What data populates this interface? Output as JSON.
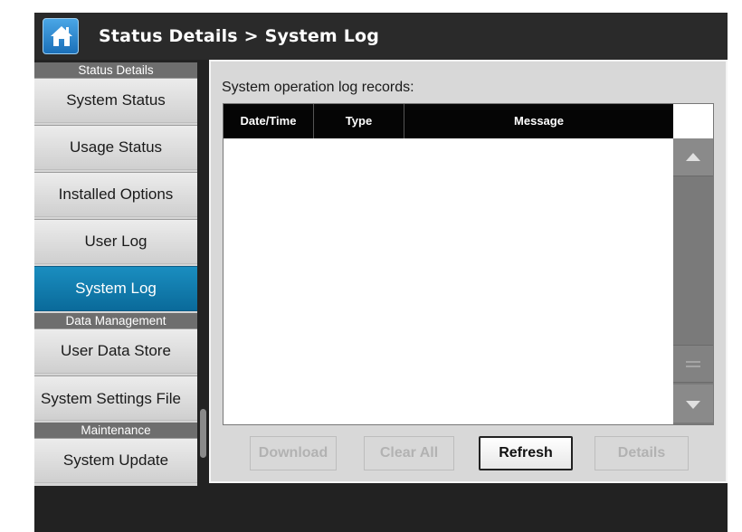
{
  "header": {
    "title": "Status Details > System Log",
    "home_icon": "home-icon"
  },
  "sidebar": {
    "sections": [
      {
        "title": "Status Details",
        "items": [
          "System Status",
          "Usage Status",
          "Installed Options",
          "User Log",
          "System Log"
        ]
      },
      {
        "title": "Data Management",
        "items": [
          "User Data Store",
          "System Settings File"
        ]
      },
      {
        "title": "Maintenance",
        "items": [
          "System Update"
        ]
      }
    ],
    "active_item": "System Log"
  },
  "content": {
    "records_label": "System operation log records:",
    "table": {
      "columns": [
        "Date/Time",
        "Type",
        "Message"
      ],
      "rows": []
    },
    "buttons": {
      "download": "Download",
      "clear_all": "Clear All",
      "refresh": "Refresh",
      "details": "Details"
    },
    "button_states": {
      "download": "disabled",
      "clear_all": "disabled",
      "refresh": "enabled",
      "details": "disabled"
    }
  },
  "colors": {
    "active_nav": "#0a7ab0",
    "header_bg": "#2a2a2a",
    "table_header_bg": "#050505"
  }
}
